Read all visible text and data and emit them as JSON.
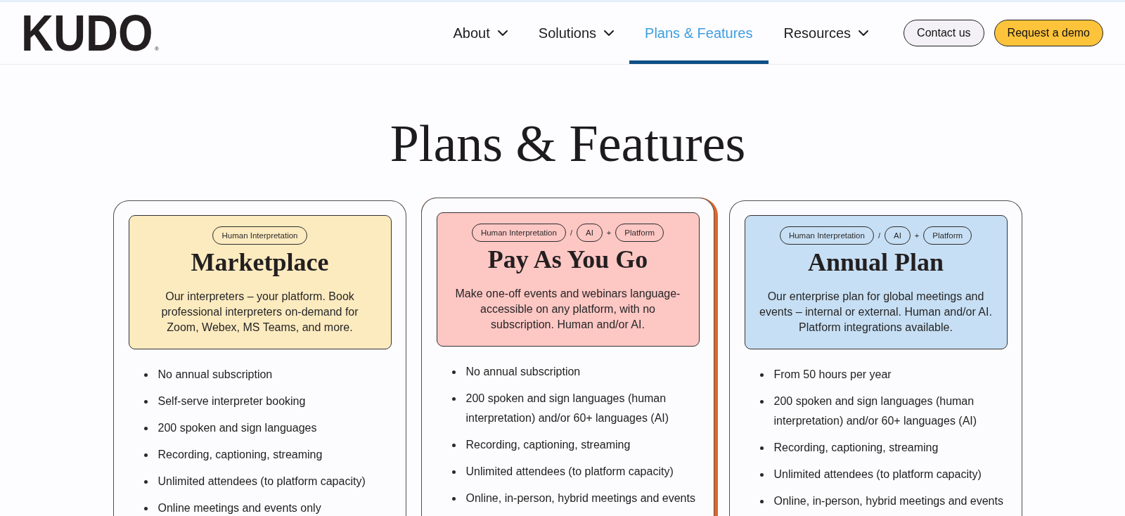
{
  "header": {
    "logo": {
      "text": "KUDO",
      "mark": "®"
    },
    "nav": [
      {
        "label": "About",
        "dropdown": true,
        "selected": false
      },
      {
        "label": "Solutions",
        "dropdown": true,
        "selected": false
      },
      {
        "label": "Plans & Features",
        "dropdown": false,
        "selected": true
      },
      {
        "label": "Resources",
        "dropdown": true,
        "selected": false
      }
    ],
    "buttons": [
      {
        "label": "Contact us",
        "kind": "secondary"
      },
      {
        "label": "Request a demo",
        "kind": "primary"
      }
    ]
  },
  "title": "Plans & Features",
  "plans": [
    {
      "name": "Marketplace",
      "color": "#fdebc0",
      "featured": false,
      "tags": [
        {
          "kind": "pill",
          "text": "Human Interpretation"
        }
      ],
      "description": "Our interpreters – your platform. Book\nprofessional interpreters on-demand for\nZoom, Webex, MS Teams, and more.",
      "features": [
        "No annual subscription",
        "Self-serve interpreter booking",
        "200 spoken and sign languages",
        "Recording, captioning, streaming",
        "Unlimited attendees (to platform capacity)",
        "Online meetings and events only"
      ]
    },
    {
      "name": "Pay As You Go",
      "color": "#fdc7c4",
      "featured": true,
      "tags": [
        {
          "kind": "pill",
          "text": "Human Interpretation"
        },
        {
          "kind": "separator",
          "text": "/"
        },
        {
          "kind": "pill",
          "text": "AI"
        },
        {
          "kind": "separator",
          "text": "+"
        },
        {
          "kind": "pill",
          "text": "Platform"
        }
      ],
      "description": "Make one-off events and webinars language-accessible on any platform, with no\nsubscription. Human and/or AI.",
      "features": [
        "No annual subscription",
        "200 spoken and sign languages (human interpretation) and/or 60+ languages (AI)",
        "Recording, captioning, streaming",
        "Unlimited attendees (to platform capacity)",
        "Online, in-person, hybrid meetings and events"
      ]
    },
    {
      "name": "Annual Plan",
      "color": "#c7dff4",
      "featured": false,
      "tags": [
        {
          "kind": "pill",
          "text": "Human Interpretation"
        },
        {
          "kind": "separator",
          "text": "/"
        },
        {
          "kind": "pill",
          "text": "AI"
        },
        {
          "kind": "separator",
          "text": "+"
        },
        {
          "kind": "pill",
          "text": "Platform"
        }
      ],
      "description": "Our enterprise plan for global meetings and\nevents – internal or external. Human and/or AI.\nPlatform integrations available.",
      "features": [
        "From 50 hours per year",
        "200 spoken and sign languages (human interpretation) and/or 60+ languages (AI)",
        "Recording, captioning, streaming",
        "Unlimited attendees (to platform capacity)",
        "Online, in-person, hybrid meetings and events"
      ]
    }
  ]
}
